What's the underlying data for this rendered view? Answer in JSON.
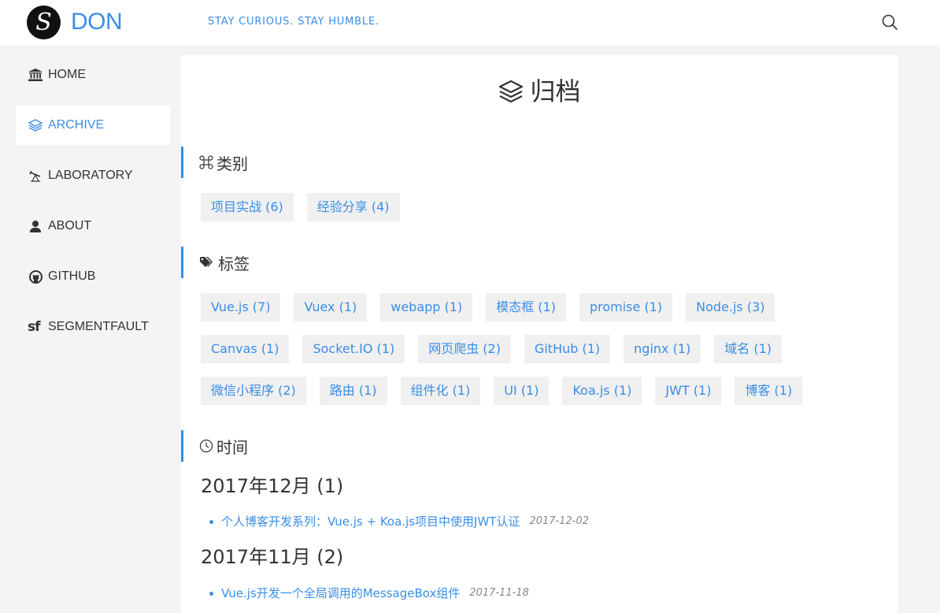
{
  "header": {
    "logo_letter": "S",
    "site_name": "DON",
    "slogan": "STAY CURIOUS. STAY HUMBLE."
  },
  "sidebar": {
    "items": [
      {
        "label": "HOME",
        "icon": "bank-icon",
        "active": false
      },
      {
        "label": "ARCHIVE",
        "icon": "layers-icon",
        "active": true
      },
      {
        "label": "LABORATORY",
        "icon": "telescope-icon",
        "active": false
      },
      {
        "label": "ABOUT",
        "icon": "user-icon",
        "active": false
      },
      {
        "label": "GITHUB",
        "icon": "github-icon",
        "active": false
      },
      {
        "label": "SEGMENTFAULT",
        "icon": "sf-icon",
        "icon_text": "sf",
        "active": false
      }
    ]
  },
  "main": {
    "title": "归档",
    "categories": {
      "title": "类别",
      "items": [
        "项目实战 (6)",
        "经验分享 (4)"
      ]
    },
    "tags": {
      "title": "标签",
      "items": [
        "Vue.js (7)",
        "Vuex (1)",
        "webapp (1)",
        "模态框 (1)",
        "promise (1)",
        "Node.js (3)",
        "Canvas (1)",
        "Socket.IO (1)",
        "网页爬虫 (2)",
        "GitHub (1)",
        "nginx (1)",
        "域名 (1)",
        "微信小程序 (2)",
        "路由 (1)",
        "组件化 (1)",
        "UI (1)",
        "Koa.js (1)",
        "JWT (1)",
        "博客 (1)"
      ]
    },
    "time": {
      "title": "时间",
      "months": [
        {
          "label": "2017年12月 (1)",
          "posts": [
            {
              "title": "个人博客开发系列：Vue.js + Koa.js项目中使用JWT认证",
              "date": "2017-12-02"
            }
          ]
        },
        {
          "label": "2017年11月 (2)",
          "posts": [
            {
              "title": "Vue.js开发一个全局调用的MessageBox组件",
              "date": "2017-11-18"
            }
          ]
        }
      ]
    }
  },
  "colors": {
    "accent": "#3a8ee6",
    "chip_bg": "#f0f0f0",
    "page_bg": "#f4f4f4"
  }
}
